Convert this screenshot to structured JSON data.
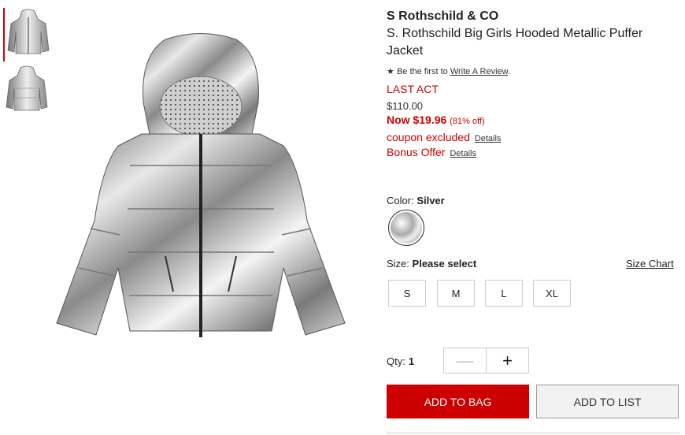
{
  "product": {
    "brand": "S Rothschild & CO",
    "title": "S. Rothschild Big Girls Hooded Metallic Puffer Jacket",
    "review_prefix": "Be the first to",
    "review_link": "Write A Review",
    "review_suffix": ".",
    "event": "LAST ACT",
    "original_price": "$110.00",
    "now_price": "Now $19.96",
    "percent_off": "(81% off)",
    "coupon_text": "coupon excluded",
    "coupon_details": "Details",
    "bonus_text": "Bonus Offer",
    "bonus_details": "Details"
  },
  "color": {
    "label": "Color:",
    "value": "Silver"
  },
  "size": {
    "label": "Size:",
    "value": "Please select",
    "chart_link": "Size Chart",
    "options": [
      "S",
      "M",
      "L",
      "XL"
    ]
  },
  "qty": {
    "label": "Qty:",
    "value": "1"
  },
  "actions": {
    "add_to_bag": "ADD TO BAG",
    "add_to_list": "ADD TO LIST"
  },
  "icons": {
    "star": "star-icon",
    "minus": "minus-icon",
    "plus": "plus-icon"
  },
  "colors": {
    "accent": "#cc0000"
  }
}
